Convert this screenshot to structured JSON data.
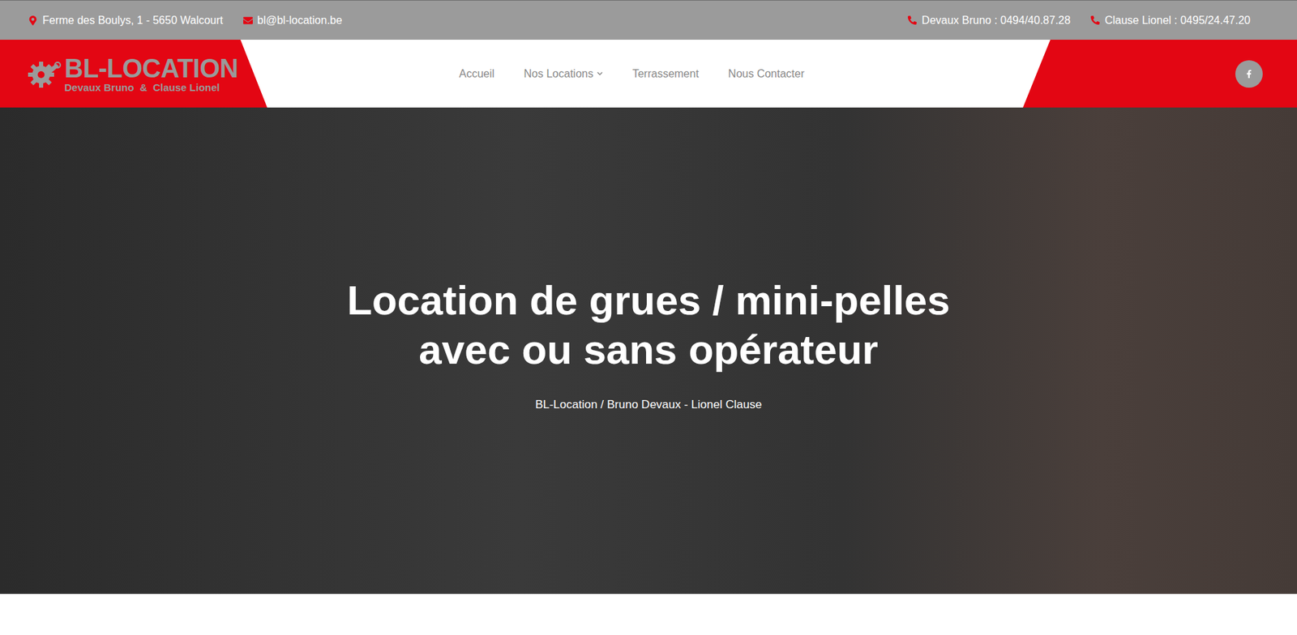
{
  "topbar": {
    "address": "Ferme des Boulys, 1 - 5650 Walcourt",
    "email": "bl@bl-location.be",
    "phones": [
      {
        "label": "Devaux Bruno : 0494/40.87.28"
      },
      {
        "label": "Clause Lionel : 0495/24.47.20"
      }
    ]
  },
  "logo": {
    "title": "BL-LOCATION",
    "subtitle": "Devaux Bruno  &  Clause Lionel"
  },
  "nav": [
    {
      "label": "Accueil",
      "has_menu": false
    },
    {
      "label": "Nos Locations",
      "has_menu": true
    },
    {
      "label": "Terrassement",
      "has_menu": false
    },
    {
      "label": "Nous Contacter",
      "has_menu": false
    }
  ],
  "hero": {
    "title_lines": [
      "Location de grues / mini-pelles",
      "avec ou sans opérateur"
    ],
    "subtitle": "BL-Location / Bruno Devaux - Lionel Clause"
  }
}
